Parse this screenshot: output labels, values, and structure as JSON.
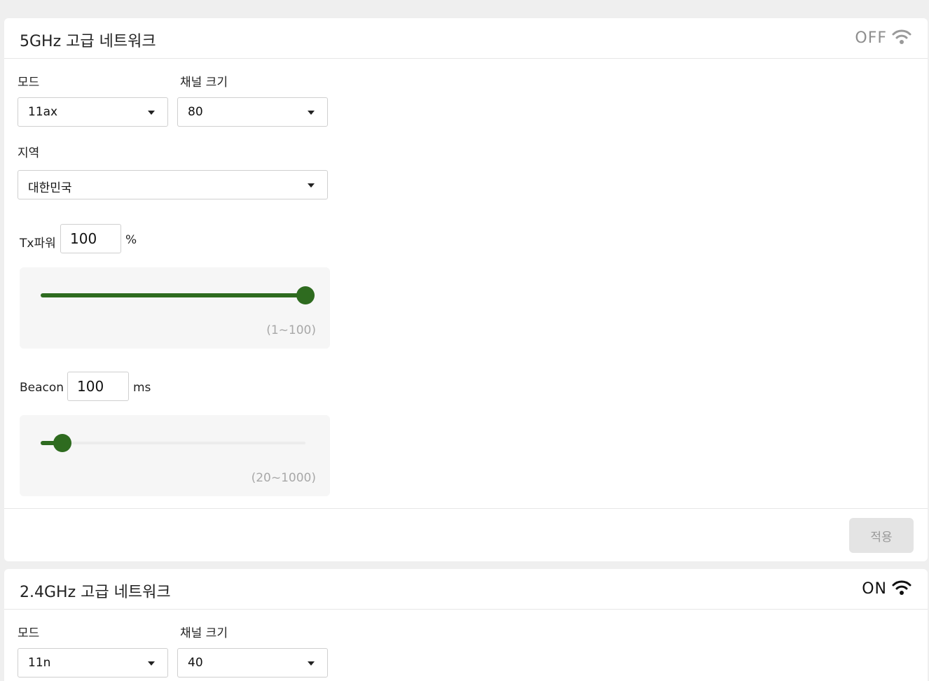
{
  "panel_5g": {
    "title": "5GHz 고급 네트워크",
    "status": "OFF",
    "mode_label": "모드",
    "mode_value": "11ax",
    "channel_label": "채널 크기",
    "channel_value": "80",
    "region_label": "지역",
    "region_value": "대한민국",
    "tx_label": "Tx파워",
    "tx_value": "100",
    "tx_unit": "%",
    "tx_slider": {
      "value": 100,
      "min": 1,
      "max": 100,
      "hint": "(1~100)"
    },
    "beacon_label": "Beacon",
    "beacon_value": "100",
    "beacon_unit": "ms",
    "beacon_slider": {
      "value": 100,
      "min": 20,
      "max": 1000,
      "hint": "(20~1000)"
    },
    "apply_label": "적용"
  },
  "panel_24g": {
    "title": "2.4GHz 고급 네트워크",
    "status": "ON",
    "mode_label": "모드",
    "mode_value": "11n",
    "channel_label": "채널 크기",
    "channel_value": "40"
  },
  "colors": {
    "accent": "#2e6b1f",
    "status_off": "#8e8e8e",
    "status_on": "#111111",
    "page_bg": "#efefef"
  },
  "icons": {
    "wifi": "wifi-icon",
    "dropdown": "chevron-down-icon"
  }
}
